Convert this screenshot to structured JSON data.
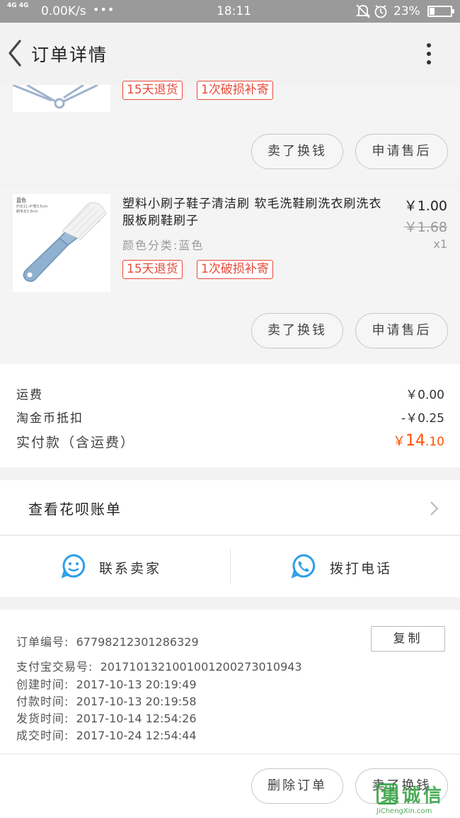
{
  "status_bar": {
    "network": "4G 4G",
    "speed": "0.00K/s",
    "dots": "•••",
    "time": "18:11",
    "battery_pct": "23%",
    "battery_level": 0.23
  },
  "nav": {
    "title": "订单详情"
  },
  "item1": {
    "tags": [
      "15天退货",
      "1次破损补寄"
    ],
    "buttons": [
      "卖了换钱",
      "申请售后"
    ]
  },
  "item2": {
    "thumb_caption": "蓝色",
    "thumb_note_1": "约长11.4*宽3.5cm",
    "thumb_note_2": "刷毛长1.8cm",
    "title": "塑料小刷子鞋子清洁刷 软毛洗鞋刷洗衣刷洗衣服板刷鞋刷子",
    "sku": "颜色分类:蓝色",
    "price": "￥1.00",
    "original_price": "￥1.68",
    "quantity": "x1",
    "tags": [
      "15天退货",
      "1次破损补寄"
    ],
    "buttons": [
      "卖了换钱",
      "申请售后"
    ]
  },
  "summary": {
    "shipping_label": "运费",
    "shipping_value": "￥0.00",
    "coin_label": "淘金币抵扣",
    "coin_value": "-￥0.25",
    "paid_label": "实付款（含运费）",
    "paid_currency": "￥",
    "paid_int": "14",
    "paid_dec": ".10",
    "paid_color": "#ff5000"
  },
  "huabei": {
    "label": "查看花呗账单"
  },
  "contact": {
    "seller_label": "联系卖家",
    "call_label": "拨打电话",
    "icon_color": "#2d9fe8"
  },
  "order_info": {
    "order_no_label": "订单编号:",
    "order_no": "67798212301286329",
    "copy_label": "复制",
    "alipay_label": "支付宝交易号:",
    "alipay_no": "2017101321001001200273010943",
    "created_label": "创建时间:",
    "created": "2017-10-13 20:19:49",
    "paid_label": "付款时间:",
    "paid": "2017-10-13 20:19:58",
    "shipped_label": "发货时间:",
    "shipped": "2017-10-14 12:54:26",
    "done_label": "成交时间:",
    "done": "2017-10-24 12:54:44"
  },
  "bottom_bar": {
    "delete_label": "删除订单",
    "sell_label": "卖了换钱"
  },
  "watermark": {
    "text": "集诚信",
    "url": "JiChengXin.com"
  }
}
